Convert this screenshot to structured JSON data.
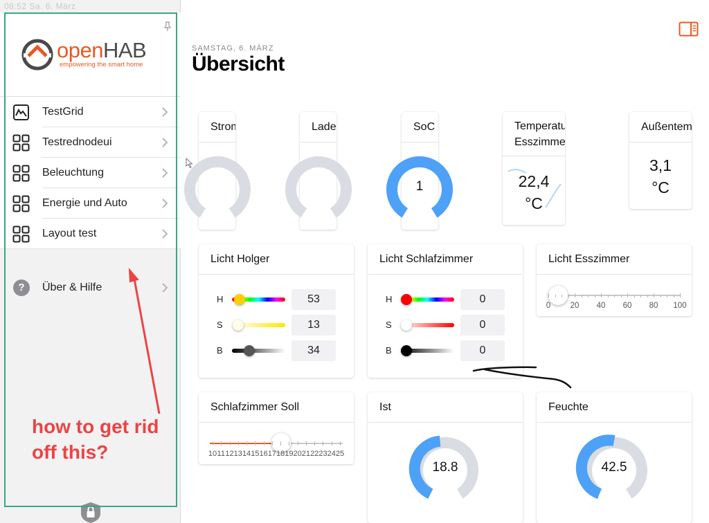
{
  "status_bar": {
    "time": "08:52  Sa. 6. März"
  },
  "sidebar": {
    "logo": {
      "open": "open",
      "hab": "HAB",
      "tagline": "empowering the smart home"
    },
    "items": [
      {
        "label": "TestGrid",
        "icon": "chart-icon"
      },
      {
        "label": "Testrednodeui",
        "icon": "grid-icon"
      },
      {
        "label": "Beleuchtung",
        "icon": "grid-icon"
      },
      {
        "label": "Energie und Auto",
        "icon": "grid-icon"
      },
      {
        "label": "Layout test",
        "icon": "grid-icon"
      }
    ],
    "help": {
      "label": "Über & Hilfe",
      "icon": "question-icon"
    }
  },
  "header": {
    "date": "SAMSTAG, 6. MÄRZ",
    "title": "Übersicht"
  },
  "cards": {
    "strom": {
      "title": "Strom"
    },
    "ladeleistung": {
      "title": "Ladeleistung"
    },
    "soc": {
      "title": "SoC",
      "value": "1"
    },
    "temp_esszimmer": {
      "title": "Temperatur Esszimmer",
      "value": "22,4",
      "unit": "°C"
    },
    "aussentemp": {
      "title": "Außentempe",
      "value": "3,1",
      "unit": "°C"
    },
    "licht_holger": {
      "title": "Licht Holger",
      "h": "53",
      "s": "13",
      "b": "34",
      "labels": [
        "H",
        "S",
        "B"
      ]
    },
    "licht_schlafzimmer": {
      "title": "Licht Schlafzimmer",
      "h": "0",
      "s": "0",
      "b": "0",
      "labels": [
        "H",
        "S",
        "B"
      ]
    },
    "licht_esszimmer": {
      "title": "Licht Esszimmer",
      "ticks": [
        "0",
        "20",
        "40",
        "60",
        "80",
        "100"
      ],
      "level": 0
    },
    "schlafzimmer_soll": {
      "title": "Schlafzimmer Soll",
      "ticks": [
        "10",
        "11",
        "12",
        "13",
        "14",
        "15",
        "16",
        "17",
        "18",
        "19",
        "20",
        "21",
        "22",
        "23",
        "24",
        "25"
      ],
      "level": 18
    },
    "ist": {
      "title": "Ist",
      "value": "18.8"
    },
    "feuchte": {
      "title": "Feuchte",
      "value": "42.5"
    }
  },
  "annotation": {
    "line1": "how to get rid",
    "line2": "off this?"
  },
  "colors": {
    "accent": "#e65a23",
    "gauge_blue": "#4da1f7",
    "gauge_grey": "#d9dce2",
    "annotation_red": "#ec4343",
    "frame_green": "#3aa588"
  }
}
